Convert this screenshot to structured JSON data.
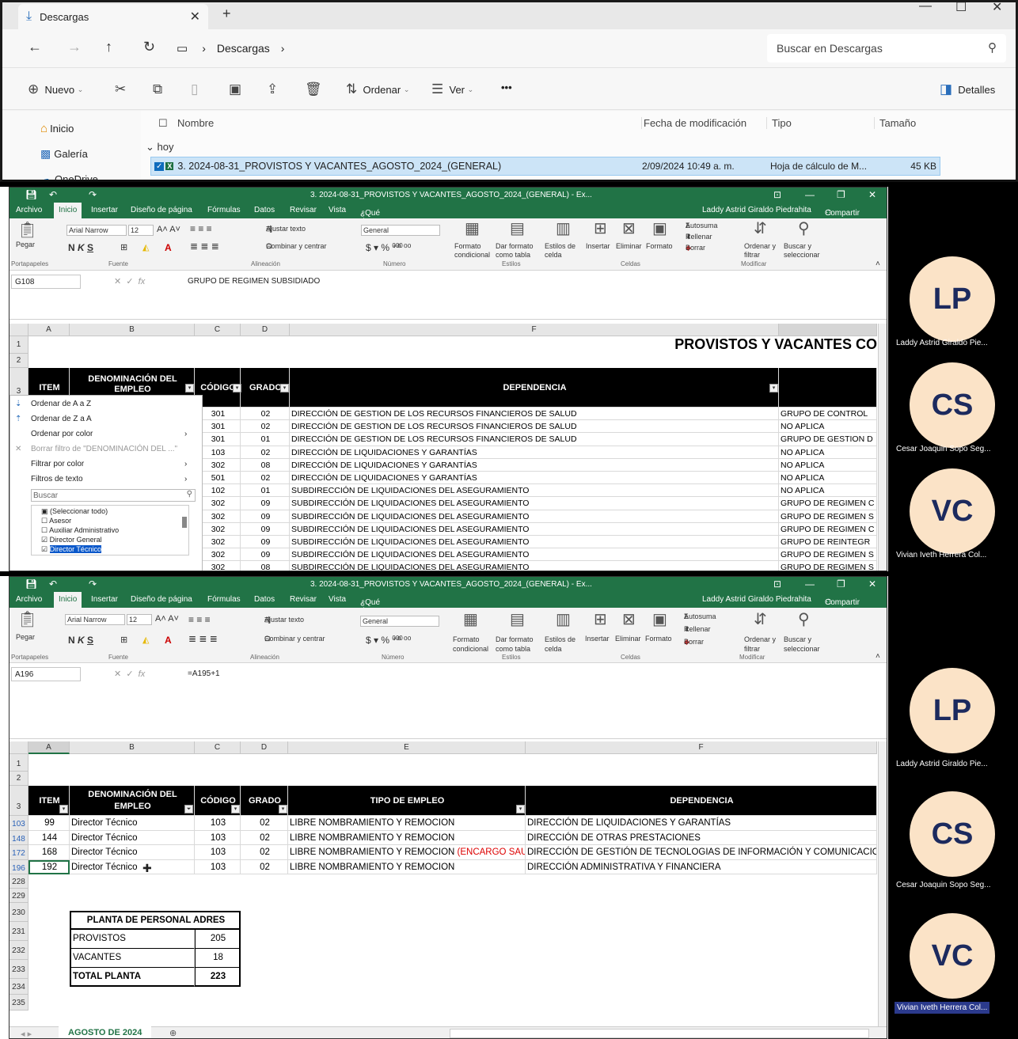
{
  "explorer": {
    "tab_title": "Descargas",
    "path": "Descargas",
    "search_placeholder": "Buscar en Descargas",
    "cmd": {
      "nuevo": "Nuevo",
      "ordenar": "Ordenar",
      "ver": "Ver",
      "more": "•••",
      "detalles": "Detalles"
    },
    "sidebar": [
      "Inicio",
      "Galería",
      "OneDrive"
    ],
    "columns": {
      "name": "Nombre",
      "date": "Fecha de modificación",
      "type": "Tipo",
      "size": "Tamaño"
    },
    "group": "hoy",
    "file": {
      "name": "3. 2024-08-31_PROVISTOS Y VACANTES_AGOSTO_2024_(GENERAL)",
      "date": "2/09/2024 10:49 a. m.",
      "type": "Hoja de cálculo de M...",
      "size": "45 KB"
    }
  },
  "excel": {
    "title": "3. 2024-08-31_PROVISTOS Y VACANTES_AGOSTO_2024_(GENERAL) - Ex...",
    "menu": [
      "Archivo",
      "Inicio",
      "Insertar",
      "Diseño de página",
      "Fórmulas",
      "Datos",
      "Revisar",
      "Vista",
      "¿Qué desea hacer?"
    ],
    "user": "Laddy Astrid Giraldo Piedrahita",
    "share": "Compartir",
    "ribbon": {
      "pegar": "Pegar",
      "font": "Arial Narrow",
      "size": "12",
      "fuente": "Fuente",
      "portapapeles": "Portapapeles",
      "ajustar": "Ajustar texto",
      "combinar": "Combinar y centrar",
      "alineacion": "Alineación",
      "general": "General",
      "numero": "Número",
      "miles": "000",
      "formato_cond": "Formato",
      "formato_cond2": "condicional",
      "dar_formato": "Dar formato",
      "dar_formato2": "como tabla",
      "estilos_celda": "Estilos de",
      "estilos_celda2": "celda",
      "estilos": "Estilos",
      "insertar": "Insertar",
      "eliminar": "Eliminar",
      "formato": "Formato",
      "celdas": "Celdas",
      "autosuma": "Autosuma",
      "rellenar": "Rellenar",
      "borrar": "Borrar",
      "ordenar": "Ordenar y",
      "ordenar2": "filtrar",
      "buscar": "Buscar y",
      "buscar2": "seleccionar",
      "modificar": "Modificar"
    }
  },
  "sheet1": {
    "namebox": "G108",
    "formula": "GRUPO DE REGIMEN SUBSIDIADO",
    "cols": [
      "A",
      "B",
      "C",
      "D",
      "F"
    ],
    "rows_h": [
      "1",
      "2",
      "3"
    ],
    "banner": "PROVISTOS Y VACANTES CO",
    "headers": {
      "item": "ITEM",
      "denom": "DENOMINACIÓN DEL",
      "denom2": "EMPLEO",
      "codigo": "CÓDIGO",
      "grado": "GRADO",
      "dependencia": "DEPENDENCIA"
    },
    "rows": [
      {
        "c": "301",
        "d": "02",
        "f": "DIRECCIÓN DE GESTION DE LOS RECURSOS FINANCIEROS DE SALUD",
        "g": "GRUPO DE CONTROL"
      },
      {
        "c": "301",
        "d": "02",
        "f": "DIRECCIÓN DE GESTION DE LOS RECURSOS FINANCIEROS DE SALUD",
        "g": "NO APLICA"
      },
      {
        "c": "301",
        "d": "01",
        "f": "DIRECCIÓN DE GESTION DE LOS RECURSOS FINANCIEROS DE SALUD",
        "g": "GRUPO DE GESTION D"
      },
      {
        "c": "103",
        "d": "02",
        "f": "DIRECCIÓN DE LIQUIDACIONES Y GARANTÍAS",
        "g": "NO APLICA"
      },
      {
        "c": "302",
        "d": "08",
        "f": "DIRECCIÓN DE LIQUIDACIONES Y GARANTÍAS",
        "g": "NO APLICA"
      },
      {
        "c": "501",
        "d": "02",
        "f": "DIRECCIÓN DE LIQUIDACIONES Y GARANTÍAS",
        "g": "NO APLICA"
      },
      {
        "c": "102",
        "d": "01",
        "f": "SUBDIRECCIÓN DE LIQUIDACIONES DEL ASEGURAMIENTO",
        "g": "NO APLICA"
      },
      {
        "c": "302",
        "d": "09",
        "f": "SUBDIRECCIÓN DE LIQUIDACIONES DEL ASEGURAMIENTO",
        "g": "GRUPO DE REGIMEN C"
      },
      {
        "c": "302",
        "d": "09",
        "f": "SUBDIRECCIÓN DE LIQUIDACIONES DEL ASEGURAMIENTO",
        "g": "GRUPO DE REGIMEN S"
      },
      {
        "c": "302",
        "d": "09",
        "f": "SUBDIRECCIÓN DE LIQUIDACIONES DEL ASEGURAMIENTO",
        "g": "GRUPO DE REGIMEN C"
      },
      {
        "c": "302",
        "d": "09",
        "f": "SUBDIRECCIÓN DE LIQUIDACIONES DEL ASEGURAMIENTO",
        "g": "GRUPO DE REINTEGR"
      },
      {
        "c": "302",
        "d": "09",
        "f": "SUBDIRECCIÓN DE LIQUIDACIONES DEL ASEGURAMIENTO",
        "g": "GRUPO DE REGIMEN S"
      },
      {
        "c": "302",
        "d": "08",
        "f": "SUBDIRECCIÓN DE LIQUIDACIONES DEL ASEGURAMIENTO",
        "g": "GRUPO DE REGIMEN S"
      }
    ],
    "filter": {
      "sort_az": "Ordenar de A a Z",
      "sort_za": "Ordenar de Z a A",
      "sort_color": "Ordenar por color",
      "clear": "Borrar filtro de \"DENOMINACIÓN DEL ...\"",
      "by_color": "Filtrar por color",
      "text_filters": "Filtros de texto",
      "search": "Buscar",
      "items": [
        "(Seleccionar todo)",
        "Asesor",
        "Auxiliar Administrativo",
        "Director General",
        "Director Técnico"
      ]
    }
  },
  "sheet2": {
    "namebox": "A196",
    "formula": "=A195+1",
    "cols": [
      "A",
      "B",
      "C",
      "D",
      "E",
      "F"
    ],
    "headers": {
      "item": "ITEM",
      "denom": "DENOMINACIÓN DEL",
      "denom2": "EMPLEO",
      "codigo": "CÓDIGO",
      "grado": "GRADO",
      "tipo": "TIPO DE EMPLEO",
      "dependencia": "DEPENDENCIA"
    },
    "rows": [
      {
        "r": "103",
        "a": "99",
        "b": "Director Técnico",
        "c": "103",
        "d": "02",
        "e": "LIBRE NOMBRAMIENTO Y REMOCION",
        "e2": "",
        "f": "DIRECCIÓN DE LIQUIDACIONES Y GARANTÍAS"
      },
      {
        "r": "148",
        "a": "144",
        "b": "Director Técnico",
        "c": "103",
        "d": "02",
        "e": "LIBRE NOMBRAMIENTO Y REMOCION",
        "e2": "",
        "f": "DIRECCIÓN DE OTRAS PRESTACIONES"
      },
      {
        "r": "172",
        "a": "168",
        "b": "Director Técnico",
        "c": "103",
        "d": "02",
        "e": "LIBRE NOMBRAMIENTO Y REMOCION",
        "e2": "(ENCARGO SAUL",
        "f": "DIRECCIÓN DE GESTIÓN DE TECNOLOGIAS DE INFORMACIÓN Y COMUNICACIONES"
      },
      {
        "r": "196",
        "a": "192",
        "b": "Director Técnico",
        "c": "103",
        "d": "02",
        "e": "LIBRE NOMBRAMIENTO Y REMOCION",
        "e2": "",
        "f": "DIRECCIÓN ADMINISTRATIVA Y FINANCIERA"
      }
    ],
    "extra_rows": [
      "1",
      "2",
      "3",
      "228",
      "229",
      "230",
      "231",
      "232",
      "233",
      "234",
      "235"
    ],
    "summary": {
      "title": "PLANTA DE PERSONAL ADRES",
      "rows": [
        {
          "l": "PROVISTOS",
          "v": "205"
        },
        {
          "l": "VACANTES",
          "v": "18"
        },
        {
          "l": "TOTAL PLANTA",
          "v": "223"
        }
      ]
    },
    "sheet_tab": "AGOSTO DE 2024"
  },
  "participants": [
    {
      "initials": "LP",
      "name": "Laddy Astrid Giraldo Pie..."
    },
    {
      "initials": "CS",
      "name": "Cesar Joaquin Sopo Seg..."
    },
    {
      "initials": "VC",
      "name": "Vivian Iveth Herrera Col..."
    }
  ],
  "colors": {
    "excel_green": "#217346",
    "avatar_bg": "#fbe3c7",
    "avatar_text": "#1c2a5e",
    "selection": "#cce4f7"
  }
}
